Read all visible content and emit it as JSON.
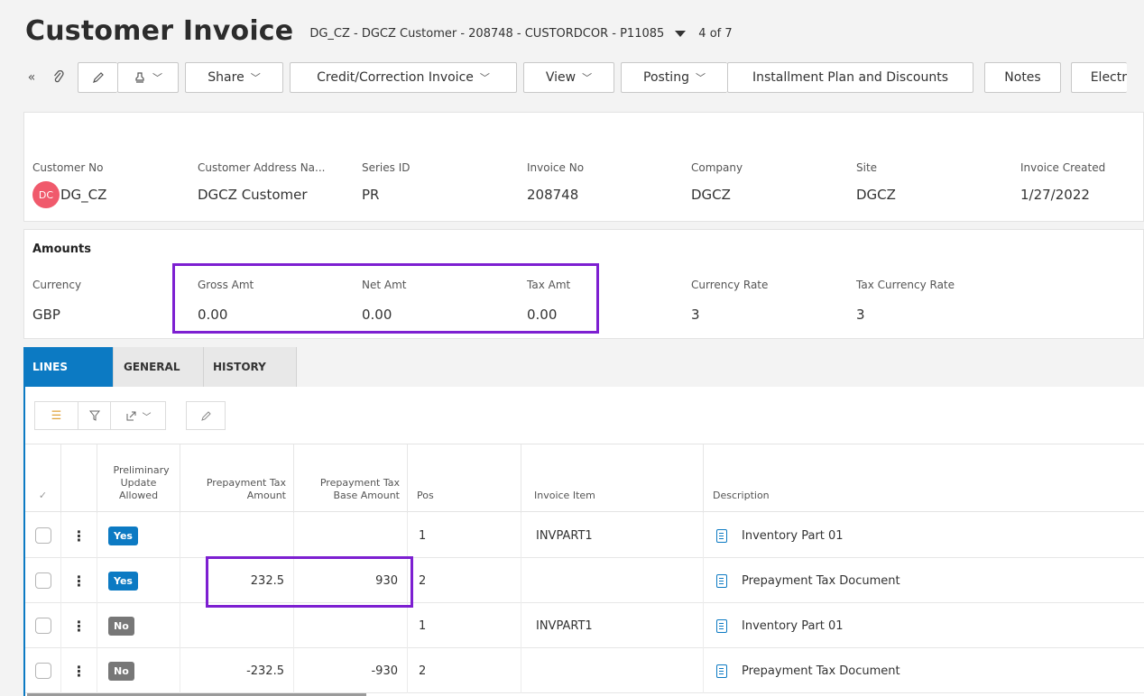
{
  "header": {
    "title": "Customer Invoice",
    "subtitle": "DG_CZ - DGCZ Customer - 208748 - CUSTORDCOR - P11085",
    "pager": "4 of 7"
  },
  "toolbar": {
    "collapse_icon": "«",
    "attach_icon": "paperclip-icon",
    "edit_icon": "pencil-icon",
    "duplicate_icon": "stamp-icon",
    "buttons": [
      {
        "label": "Share"
      },
      {
        "label": "Credit/Correction Invoice"
      },
      {
        "label": "View"
      },
      {
        "label": "Posting"
      },
      {
        "label": "Installment Plan and Discounts"
      },
      {
        "label": "Notes"
      },
      {
        "label": "Electr"
      }
    ]
  },
  "header_fields": [
    {
      "label": "Customer No",
      "value": "DG_CZ",
      "avatar": "DC"
    },
    {
      "label": "Customer Address Na...",
      "value": "DGCZ Customer"
    },
    {
      "label": "Series ID",
      "value": "PR"
    },
    {
      "label": "Invoice No",
      "value": "208748"
    },
    {
      "label": "Company",
      "value": "DGCZ"
    },
    {
      "label": "Site",
      "value": "DGCZ"
    },
    {
      "label": "Invoice Created",
      "value": "1/27/2022"
    }
  ],
  "amounts": {
    "title": "Amounts",
    "fields": [
      {
        "label": "Currency",
        "value": "GBP"
      },
      {
        "label": "Gross Amt",
        "value": "0.00"
      },
      {
        "label": "Net Amt",
        "value": "0.00"
      },
      {
        "label": "Tax Amt",
        "value": "0.00"
      },
      {
        "label": "Currency Rate",
        "value": "3"
      },
      {
        "label": "Tax Currency Rate",
        "value": "3"
      }
    ]
  },
  "tabs": [
    {
      "label": "LINES",
      "active": true
    },
    {
      "label": "GENERAL"
    },
    {
      "label": "HISTORY"
    }
  ],
  "grid": {
    "select_all_icon": "✓",
    "columns": [
      "Preliminary Update Allowed",
      "Prepayment Tax Amount",
      "Prepayment Tax Base Amount",
      "Pos",
      "Invoice Item",
      "Description"
    ],
    "rows": [
      {
        "prelim": "Yes",
        "tax_amount": "",
        "tax_base": "",
        "pos": "1",
        "item": "INVPART1",
        "description": "Inventory Part 01"
      },
      {
        "prelim": "Yes",
        "tax_amount": "232.5",
        "tax_base": "930",
        "pos": "2",
        "item": "",
        "description": "Prepayment Tax Document"
      },
      {
        "prelim": "No",
        "tax_amount": "",
        "tax_base": "",
        "pos": "1",
        "item": "INVPART1",
        "description": "Inventory Part 01"
      },
      {
        "prelim": "No",
        "tax_amount": "-232.5",
        "tax_base": "-930",
        "pos": "2",
        "item": "",
        "description": "Prepayment Tax Document"
      }
    ]
  },
  "colors": {
    "accent": "#0c7ac3",
    "highlight": "#7d1fd1",
    "avatar": "#f05a6c",
    "badge_no": "#777777"
  }
}
